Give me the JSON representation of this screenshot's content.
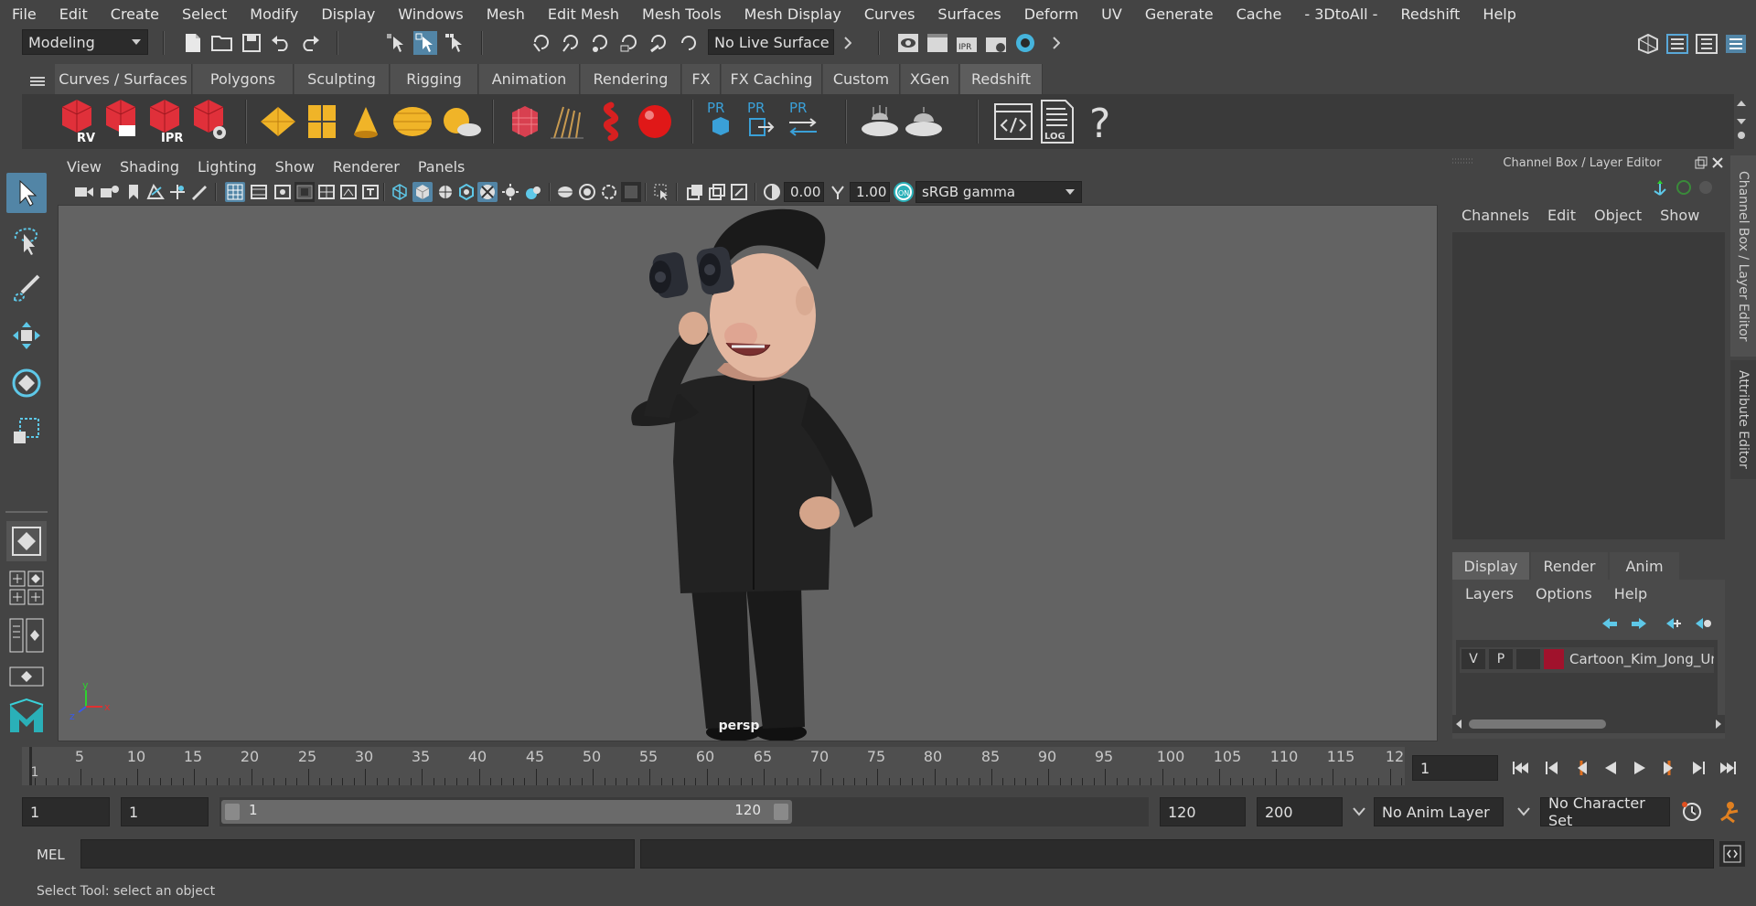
{
  "menubar": {
    "items": [
      "File",
      "Edit",
      "Create",
      "Select",
      "Modify",
      "Display",
      "Windows",
      "Mesh",
      "Edit Mesh",
      "Mesh Tools",
      "Mesh Display",
      "Curves",
      "Surfaces",
      "Deform",
      "UV",
      "Generate",
      "Cache",
      "- 3DtoAll -",
      "Redshift",
      "Help"
    ]
  },
  "statusline": {
    "menuset": "Modeling",
    "live_surface": "No Live Surface"
  },
  "shelf": {
    "tabs": [
      "Curves / Surfaces",
      "Polygons",
      "Sculpting",
      "Rigging",
      "Animation",
      "Rendering",
      "FX",
      "FX Caching",
      "Custom",
      "XGen",
      "Redshift"
    ],
    "active_tab": "Redshift",
    "icons": {
      "rv": "RV",
      "ipr": "IPR",
      "pr1": "PR",
      "pr2": "PR",
      "pr3": "PR",
      "log": "LOG",
      "help": "?"
    }
  },
  "viewport": {
    "menu": [
      "View",
      "Shading",
      "Lighting",
      "Show",
      "Renderer",
      "Panels"
    ],
    "exposure": "0.00",
    "gamma": "1.00",
    "color_space": "sRGB gamma",
    "camera_label": "persp",
    "axis_y": "y",
    "axis_x": "x",
    "axis_z": "z",
    "background_color": "#636363"
  },
  "channel_box": {
    "title": "Channel Box / Layer Editor",
    "menu": [
      "Channels",
      "Edit",
      "Object",
      "Show"
    ],
    "layer_tabs": [
      "Display",
      "Render",
      "Anim"
    ],
    "active_layer_tab": "Display",
    "layer_menu": [
      "Layers",
      "Options",
      "Help"
    ],
    "layer": {
      "visible": "V",
      "playback": "P",
      "name": "Cartoon_Kim_Jong_Un",
      "color": "#a0122c"
    },
    "side_tabs": [
      "Channel Box / Layer Editor",
      "Attribute Editor"
    ]
  },
  "timeline": {
    "ticks": [
      "1",
      "5",
      "10",
      "15",
      "20",
      "25",
      "30",
      "35",
      "40",
      "45",
      "50",
      "55",
      "60",
      "65",
      "70",
      "75",
      "80",
      "85",
      "90",
      "95",
      "100",
      "105",
      "110",
      "115",
      "12"
    ],
    "current_frame": "1"
  },
  "range": {
    "start": "1",
    "playback_start": "1",
    "slider_start": "1",
    "slider_end": "120",
    "playback_end": "120",
    "end": "200",
    "anim_layer": "No Anim Layer",
    "character_set": "No Character Set"
  },
  "cmdline": {
    "lang": "MEL"
  },
  "helpline": {
    "text": "Select Tool: select an object"
  },
  "colors": {
    "accent": "#5285a6",
    "redshift_red": "#e0303a",
    "gold": "#f0b428",
    "cyan": "#3aa0d8"
  }
}
